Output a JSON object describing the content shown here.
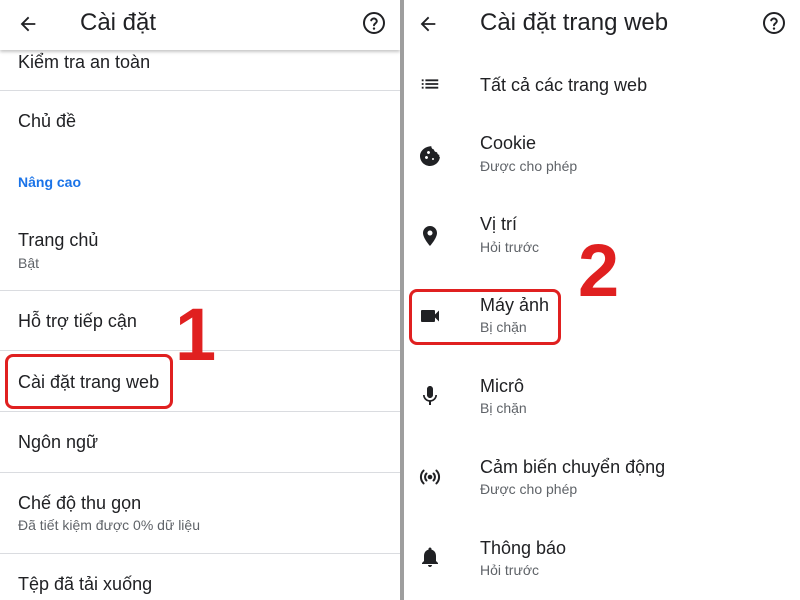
{
  "left": {
    "title": "Cài đặt",
    "items": {
      "safety": "Kiểm tra an toàn",
      "theme": "Chủ đề",
      "advanced_header": "Nâng cao",
      "homepage": "Trang chủ",
      "homepage_sub": "Bật",
      "accessibility": "Hỗ trợ tiếp cận",
      "site_settings": "Cài đặt trang web",
      "language": "Ngôn ngữ",
      "lite_mode": "Chế độ thu gọn",
      "lite_mode_sub": "Đã tiết kiệm được 0% dữ liệu",
      "downloads": "Tệp đã tải xuống"
    },
    "step_label": "1"
  },
  "right": {
    "title": "Cài đặt trang web",
    "all_sites": "Tất cả các trang web",
    "items": [
      {
        "label": "Cookie",
        "sub": "Được cho phép",
        "icon": "cookie-icon"
      },
      {
        "label": "Vị trí",
        "sub": "Hỏi trước",
        "icon": "location-pin-icon"
      },
      {
        "label": "Máy ảnh",
        "sub": "Bị chặn",
        "icon": "camera-icon"
      },
      {
        "label": "Micrô",
        "sub": "Bị chặn",
        "icon": "microphone-icon"
      },
      {
        "label": "Cảm biến chuyển động",
        "sub": "Được cho phép",
        "icon": "motion-sensor-icon"
      },
      {
        "label": "Thông báo",
        "sub": "Hỏi trước",
        "icon": "bell-icon"
      }
    ],
    "step_label": "2"
  },
  "colors": {
    "accent_blue": "#1a73e8",
    "highlight_red": "#e02020",
    "text_primary": "#202124",
    "text_secondary": "#5f6368"
  }
}
